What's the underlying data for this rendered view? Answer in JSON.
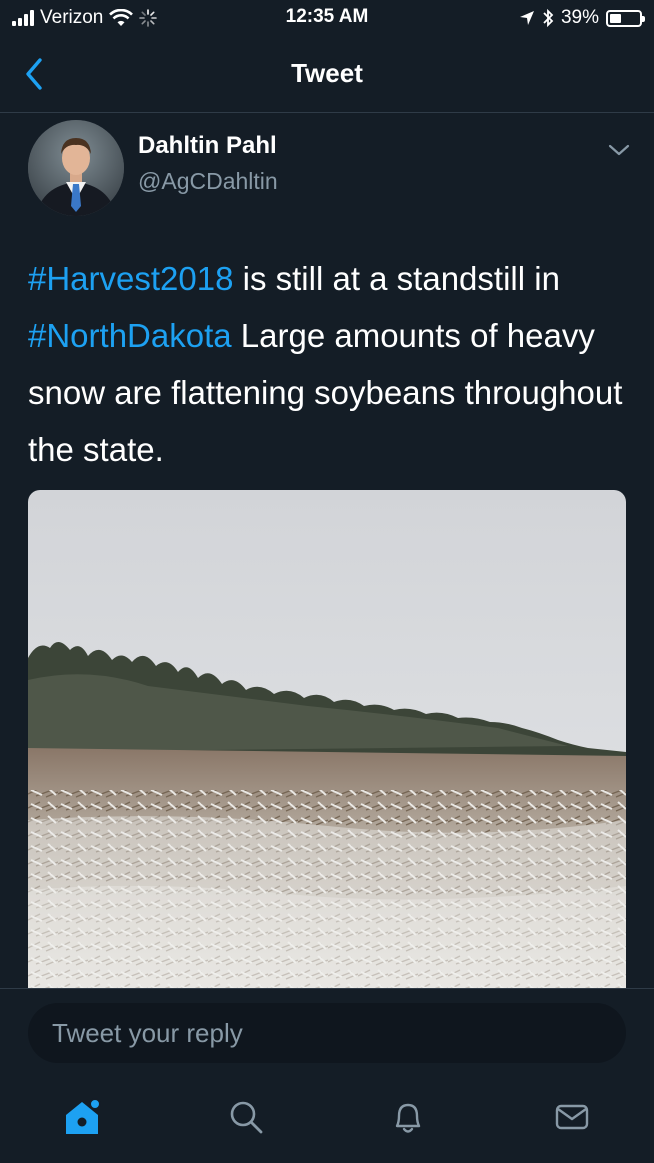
{
  "status_bar": {
    "carrier": "Verizon",
    "time": "12:35 AM",
    "battery_percent": "39%",
    "battery_level": 0.39
  },
  "nav": {
    "title": "Tweet"
  },
  "tweet": {
    "author": {
      "name": "Dahltin Pahl",
      "handle": "@AgCDahltin"
    },
    "text": {
      "hashtag1": "#Harvest2018",
      "part1": " is still at a standstill in ",
      "hashtag2": "#NorthDakota",
      "part2": " Large amounts of heavy snow are flattening soybeans throughout the state."
    }
  },
  "reply": {
    "placeholder": "Tweet your reply"
  },
  "colors": {
    "background": "#141d26",
    "accent": "#1da1f2",
    "secondary_text": "#8899a6"
  },
  "icons": [
    "signal-icon",
    "wifi-icon",
    "activity-spinner-icon",
    "location-arrow-icon",
    "bluetooth-icon",
    "battery-icon",
    "back-chevron-icon",
    "caret-down-icon",
    "home-icon",
    "search-icon",
    "notifications-bell-icon",
    "messages-envelope-icon"
  ]
}
